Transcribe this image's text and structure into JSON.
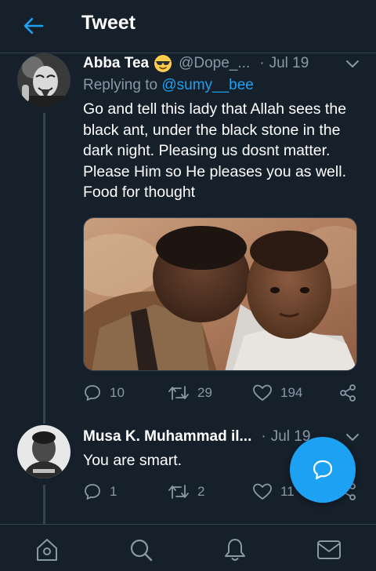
{
  "header": {
    "title": "Tweet"
  },
  "tweets": [
    {
      "name": "Abba Tea",
      "handle": "@Dope_...",
      "date": "Jul 19",
      "replying_prefix": "Replying to ",
      "replying_to": "@sumy__bee",
      "text": "Go and tell this lady that Allah sees the black ant,  under the black stone in the dark night.  Pleasing us dosnt matter.  Please Him so He pleases you as well.  Food for thought",
      "replies": "10",
      "retweets": "29",
      "likes": "194"
    },
    {
      "name": "Musa K. Muhammad il...",
      "date": "Jul 19",
      "text": "You are smart.",
      "replies": "1",
      "retweets": "2",
      "likes": "11"
    }
  ],
  "colors": {
    "background": "#15202b",
    "accent": "#1da1f2",
    "secondary_text": "#8899a6",
    "divider": "#38444d"
  },
  "icons": {
    "back": "arrow-left-icon",
    "caret": "chevron-down-icon",
    "reply": "comment-icon",
    "retweet": "retweet-icon",
    "like": "heart-icon",
    "share": "share-icon",
    "compose": "compose-reply-icon",
    "nav": [
      "home-icon",
      "search-icon",
      "notifications-icon",
      "messages-icon"
    ]
  }
}
